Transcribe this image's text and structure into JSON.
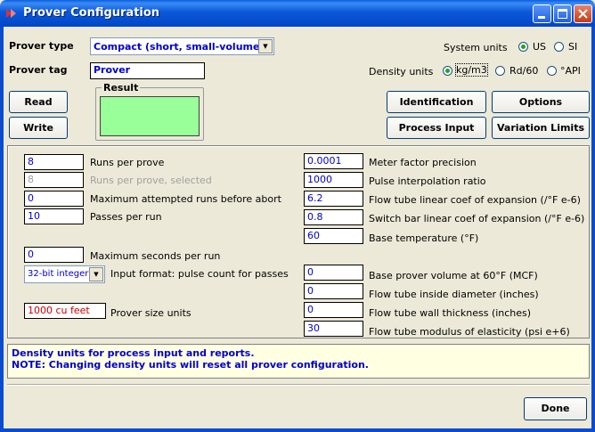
{
  "window": {
    "title": "Prover Configuration"
  },
  "prover_type": {
    "label": "Prover type",
    "value": "Compact (short, small-volume)"
  },
  "prover_tag": {
    "label": "Prover tag",
    "value": "Prover"
  },
  "system_units": {
    "label": "System units",
    "options": [
      "US",
      "SI"
    ],
    "selected": "US"
  },
  "density_units": {
    "label": "Density units",
    "options": [
      "kg/m3",
      "Rd/60",
      "°API"
    ],
    "selected": "kg/m3"
  },
  "buttons": {
    "read": "Read",
    "write": "Write",
    "identification": "Identification",
    "options": "Options",
    "process_input": "Process Input",
    "variation_limits": "Variation Limits",
    "done": "Done"
  },
  "result": {
    "label": "Result",
    "color": "#99ff99"
  },
  "left_fields": [
    {
      "value": "8",
      "label": "Runs per prove",
      "disabled": false
    },
    {
      "value": "8",
      "label": "Runs per prove, selected",
      "disabled": true
    },
    {
      "value": "0",
      "label": "Maximum attempted runs before abort",
      "disabled": false
    },
    {
      "value": "10",
      "label": "Passes per run",
      "disabled": false
    }
  ],
  "max_seconds": {
    "value": "0",
    "label": "Maximum seconds per run"
  },
  "input_format": {
    "value": "32-bit integer",
    "label": "Input format: pulse count for passes"
  },
  "prover_size_units": {
    "value": "1000 cu feet",
    "label": "Prover size units"
  },
  "right_fields_top": [
    {
      "value": "0.0001",
      "label": "Meter factor precision"
    },
    {
      "value": "1000",
      "label": "Pulse interpolation ratio"
    },
    {
      "value": "6.2",
      "label": "Flow tube linear coef of expansion (/°F e-6)"
    },
    {
      "value": "0.8",
      "label": "Switch bar linear coef of expansion (/°F e-6)"
    },
    {
      "value": "60",
      "label": "Base temperature (°F)"
    }
  ],
  "right_fields_bottom": [
    {
      "value": "0",
      "label": "Base prover volume at 60°F (MCF)"
    },
    {
      "value": "0",
      "label": "Flow tube inside diameter (inches)"
    },
    {
      "value": "0",
      "label": "Flow tube wall thickness (inches)"
    },
    {
      "value": "30",
      "label": "Flow tube modulus of elasticity (psi e+6)"
    }
  ],
  "message": {
    "line1": "Density units for process input and reports.",
    "line2": "NOTE: Changing density units will reset all prover configuration."
  }
}
